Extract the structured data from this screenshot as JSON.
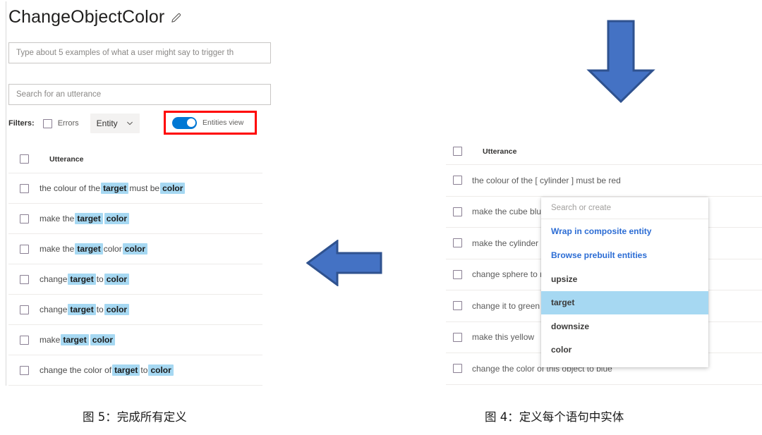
{
  "left_figure": {
    "app_title": "ChangeObjectColor",
    "edit_icon": "pencil-icon",
    "examples_field": {
      "placeholder": "Type about 5 examples of what a user might say to trigger th",
      "value": ""
    },
    "search_field": {
      "placeholder": "Search for an utterance",
      "value": ""
    },
    "filters": {
      "label": "Filters:",
      "errors_checkbox_label": "Errors",
      "errors_checked": false,
      "entity_dropdown_label": "Entity",
      "chevron_icon": "chevron-down-icon",
      "entities_view_toggle_label": "Entities view",
      "entities_view_on": true,
      "highlight_color": "#ff0000",
      "toggle_on_color": "#0078d4"
    },
    "table": {
      "header_checkbox_checked": false,
      "column_header": "Utterance",
      "entity_highlight_color": "#a6d8f2",
      "rows": [
        {
          "checked": false,
          "tokens": [
            {
              "text": "the colour of the ",
              "entity": false
            },
            {
              "text": "target",
              "entity": true
            },
            {
              "text": " must be ",
              "entity": false
            },
            {
              "text": "color",
              "entity": true
            }
          ]
        },
        {
          "checked": false,
          "tokens": [
            {
              "text": "make the ",
              "entity": false
            },
            {
              "text": "target",
              "entity": true
            },
            {
              "text": " ",
              "entity": false
            },
            {
              "text": "color",
              "entity": true
            }
          ]
        },
        {
          "checked": false,
          "tokens": [
            {
              "text": "make the ",
              "entity": false
            },
            {
              "text": "target",
              "entity": true
            },
            {
              "text": " color ",
              "entity": false
            },
            {
              "text": "color",
              "entity": true
            }
          ]
        },
        {
          "checked": false,
          "tokens": [
            {
              "text": "change ",
              "entity": false
            },
            {
              "text": "target",
              "entity": true
            },
            {
              "text": " to ",
              "entity": false
            },
            {
              "text": "color",
              "entity": true
            }
          ]
        },
        {
          "checked": false,
          "tokens": [
            {
              "text": "change ",
              "entity": false
            },
            {
              "text": "target",
              "entity": true
            },
            {
              "text": " to ",
              "entity": false
            },
            {
              "text": "color",
              "entity": true
            }
          ]
        },
        {
          "checked": false,
          "tokens": [
            {
              "text": "make ",
              "entity": false
            },
            {
              "text": "target",
              "entity": true
            },
            {
              "text": " ",
              "entity": false
            },
            {
              "text": "color",
              "entity": true
            }
          ]
        },
        {
          "checked": false,
          "tokens": [
            {
              "text": "change the color of ",
              "entity": false
            },
            {
              "text": "target",
              "entity": true
            },
            {
              "text": " to ",
              "entity": false
            },
            {
              "text": "color",
              "entity": true
            }
          ]
        }
      ]
    }
  },
  "right_figure": {
    "table": {
      "header_checkbox_checked": false,
      "column_header": "Utterance",
      "rows": [
        {
          "checked": false,
          "text": "the colour of the [ cylinder ] must be red"
        },
        {
          "checked": false,
          "text": "make the cube blue"
        },
        {
          "checked": false,
          "text": "make the cylinder red"
        },
        {
          "checked": false,
          "text": "change sphere to red"
        },
        {
          "checked": false,
          "text": "change it to green"
        },
        {
          "checked": false,
          "text": "make this yellow"
        },
        {
          "checked": false,
          "text": "change the color of this object to blue"
        }
      ]
    },
    "entity_picker": {
      "search_placeholder": "Search or create",
      "search_value": "",
      "links": [
        "Wrap in composite entity",
        "Browse prebuilt entities"
      ],
      "link_color": "#2b6cd4",
      "options": [
        {
          "label": "upsize",
          "selected": false
        },
        {
          "label": "target",
          "selected": true
        },
        {
          "label": "downsize",
          "selected": false
        },
        {
          "label": "color",
          "selected": false
        }
      ],
      "selected_bg": "#a6d8f2"
    }
  },
  "arrows": {
    "down_arrow_name": "arrow-down-icon",
    "left_arrow_name": "arrow-left-icon",
    "fill": "#4472c4",
    "stroke": "#2f528f"
  },
  "captions": {
    "left": "图 5：完成所有定义",
    "right": "图 4：定义每个语句中实体"
  }
}
